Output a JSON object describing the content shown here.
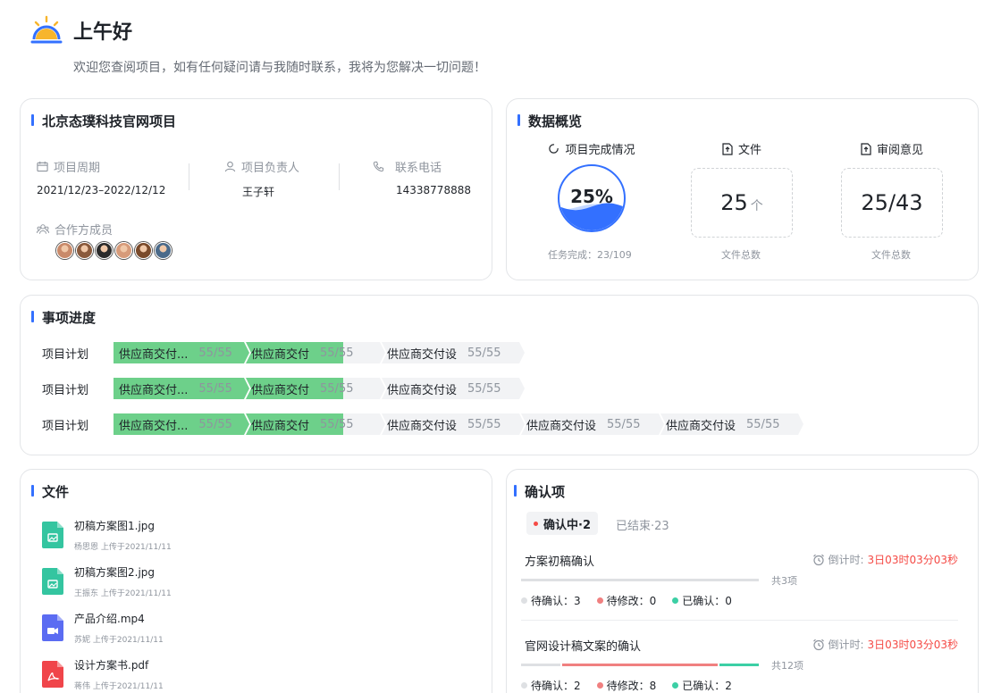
{
  "greeting": {
    "title": "上午好",
    "subtitle": "欢迎您查阅项目，如有任何疑问请与我随时联系，我将为您解决一切问题！"
  },
  "project": {
    "title": "北京态璞科技官网项目",
    "period_label": "项目周期",
    "period_value": "2021/12/23–2022/12/12",
    "owner_label": "项目负责人",
    "owner_value": "王子轩",
    "phone_label": "联系电话",
    "phone_value": "14338778888",
    "members_label": "合作方成员",
    "member_colors": [
      "#c98a6a",
      "#8a5a3c",
      "#2b2b2b",
      "#d79b7a",
      "#7a4a2a",
      "#4a6a8a"
    ]
  },
  "overview": {
    "title": "数据概览",
    "completion_label": "项目完成情况",
    "completion_text": "25%",
    "completion_fraction": 0.25,
    "completion_foot": "任务完成：23/109",
    "files_label": "文件",
    "files_num": "25",
    "files_unit": "个",
    "files_foot": "文件总数",
    "review_label": "审阅意见",
    "review_num": "25/43",
    "review_foot": "文件总数"
  },
  "progress": {
    "title": "事项进度",
    "rows": [
      {
        "label": "项目计划",
        "steps": [
          {
            "name": "供应商交付...",
            "count": "55/55",
            "done": true
          },
          {
            "name": "供应商交付",
            "count": "55/55",
            "done": true
          },
          {
            "name": "供应商交付设",
            "count": "55/55",
            "done": false
          }
        ]
      },
      {
        "label": "项目计划",
        "steps": [
          {
            "name": "供应商交付...",
            "count": "55/55",
            "done": true
          },
          {
            "name": "供应商交付",
            "count": "55/55",
            "done": true
          },
          {
            "name": "供应商交付设",
            "count": "55/55",
            "done": false
          }
        ]
      },
      {
        "label": "项目计划",
        "steps": [
          {
            "name": "供应商交付...",
            "count": "55/55",
            "done": true
          },
          {
            "name": "供应商交付",
            "count": "55/55",
            "done": true
          },
          {
            "name": "供应商交付设",
            "count": "55/55",
            "done": false
          },
          {
            "name": "供应商交付设",
            "count": "55/55",
            "done": false
          },
          {
            "name": "供应商交付设",
            "count": "55/55",
            "done": false
          }
        ]
      }
    ]
  },
  "files": {
    "title": "文件",
    "items": [
      {
        "name": "初稿方案图1.jpg",
        "meta": "杨思恩 上传于2021/11/11",
        "type": "image",
        "color": "#34c5a0"
      },
      {
        "name": "初稿方案图2.jpg",
        "meta": "王振东 上传于2021/11/11",
        "type": "image",
        "color": "#34c5a0"
      },
      {
        "name": "产品介绍.mp4",
        "meta": "苏妮 上传于2021/11/11",
        "type": "video",
        "color": "#5b6cf2"
      },
      {
        "name": "设计方案书.pdf",
        "meta": "蒋伟 上传于2021/11/11",
        "type": "pdf",
        "color": "#f0454a"
      }
    ]
  },
  "confirm": {
    "title": "确认项",
    "tab_active": "确认中·2",
    "tab_inactive": "已结束·23",
    "deadline_label": "倒计时:",
    "items": [
      {
        "title": "方案初稿确认",
        "deadline": "3日03时03分03秒",
        "total": "共3项",
        "pending": "待确认：3",
        "modify": "待修改：0",
        "confirmed": "已确认：0",
        "parts": [
          1,
          0,
          0
        ]
      },
      {
        "title": "官网设计稿文案的确认",
        "deadline": "3日03时03分03秒",
        "total": "共12项",
        "pending": "待确认：2",
        "modify": "待修改：8",
        "confirmed": "已确认：2",
        "parts": [
          2,
          8,
          2
        ]
      }
    ],
    "colors": {
      "pending": "#dee0e3",
      "modify": "#f08080",
      "confirmed": "#3ccfa5"
    }
  }
}
